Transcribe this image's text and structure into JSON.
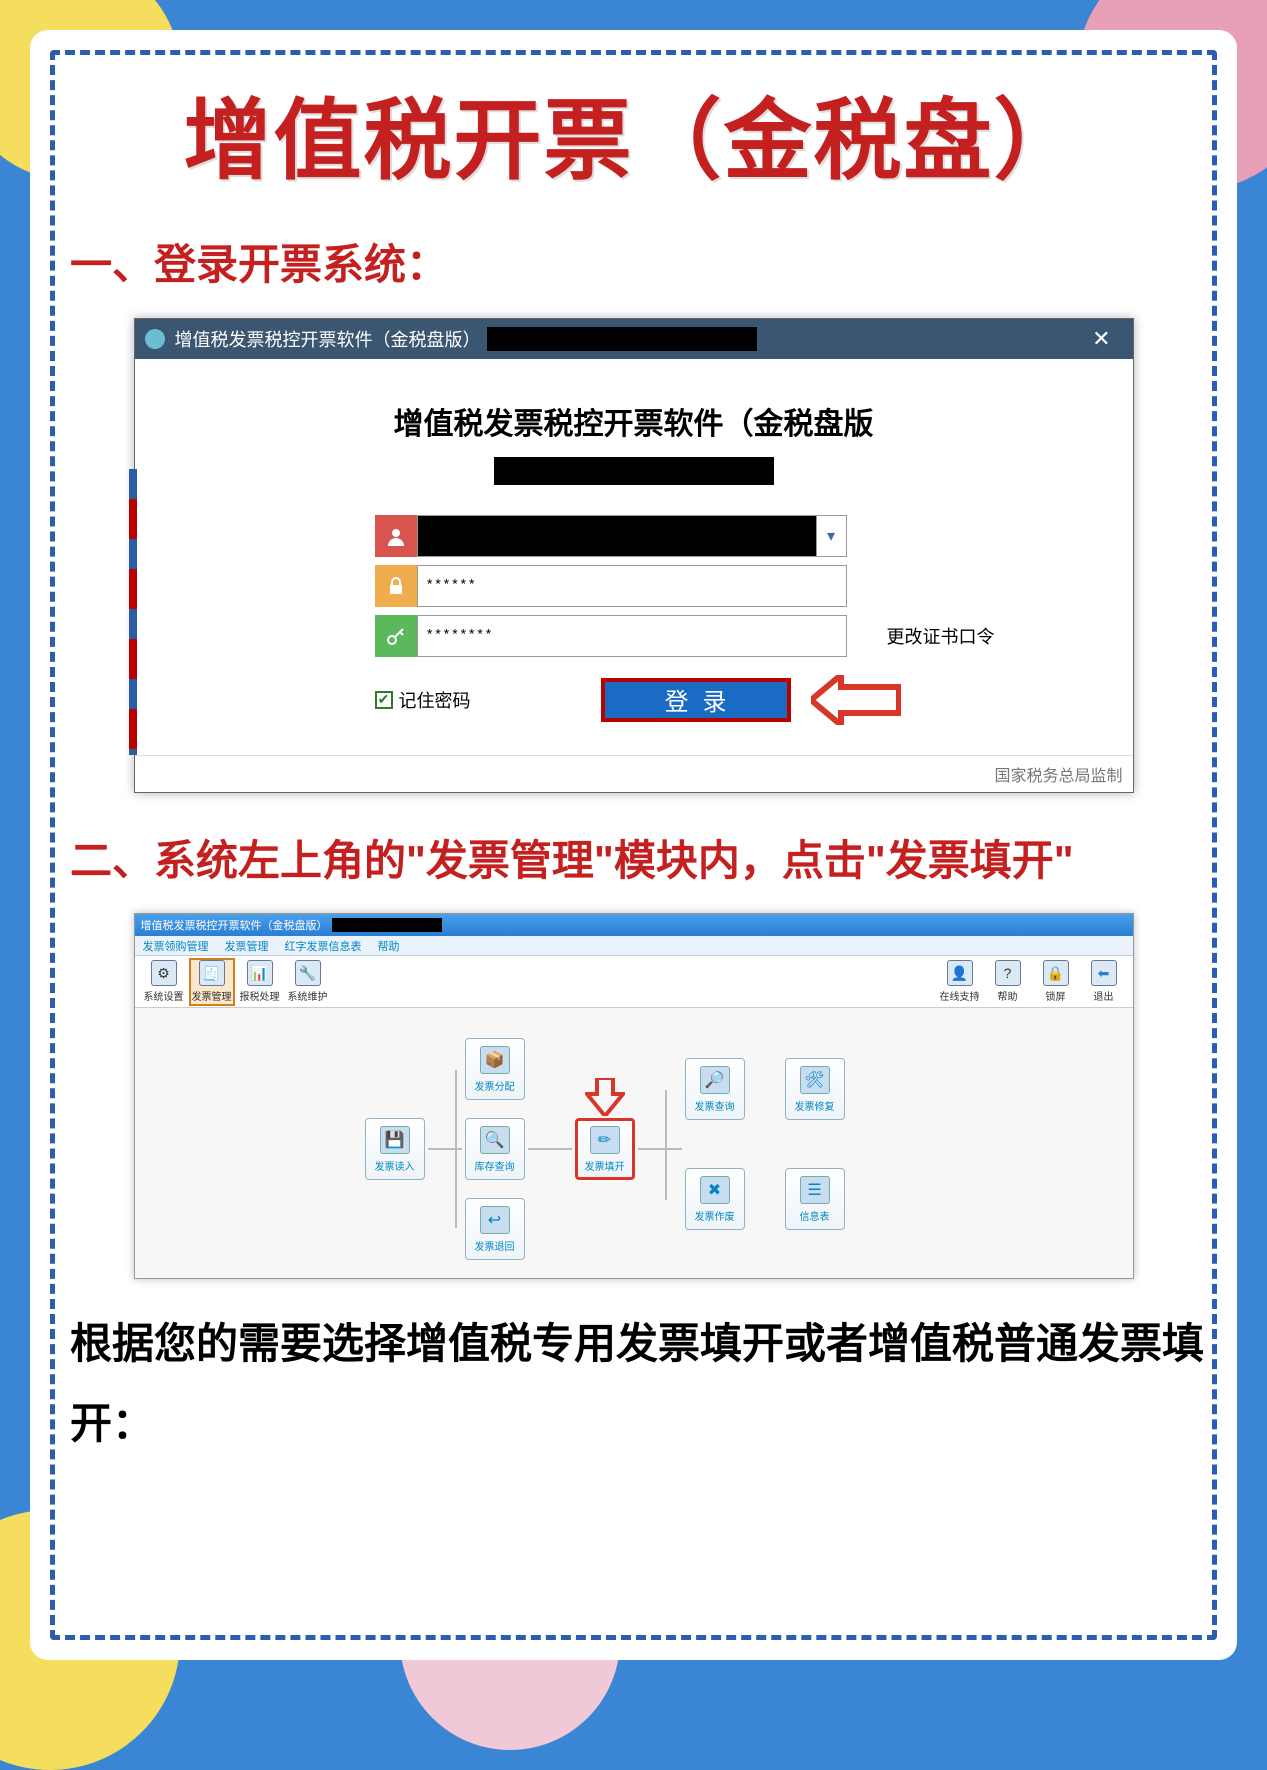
{
  "page_title": "增值税开票（金税盘）",
  "section1": "一、登录开票系统：",
  "login_window": {
    "titlebar_text": "增值税发票税控开票软件（金税盘版）",
    "heading": "增值税发票税控开票软件（金税盘版",
    "user_value": "",
    "pass_value": "******",
    "cert_value": "********",
    "change_cert_link": "更改证书口令",
    "remember_label": "记住密码",
    "login_btn": "登录",
    "footer": "国家税务总局监制",
    "close_icon": "✕"
  },
  "section2": "二、系统左上角的\"发票管理\"模块内，点击\"发票填开\"",
  "module_window": {
    "titlebar_text": "增值税发票税控开票软件（金税盘版）",
    "menu_items": [
      "发票领购管理",
      "发票管理",
      "红字发票信息表",
      "帮助"
    ],
    "toolbar_left": [
      {
        "label": "系统设置"
      },
      {
        "label": "发票管理",
        "highlight": true
      },
      {
        "label": "报税处理"
      },
      {
        "label": "系统维护"
      }
    ],
    "toolbar_right": [
      {
        "label": "在线支持"
      },
      {
        "label": "帮助"
      },
      {
        "label": "锁屏"
      },
      {
        "label": "退出"
      }
    ],
    "nodes": {
      "read": {
        "label": "发票读入"
      },
      "dist": {
        "label": "发票分配"
      },
      "stock": {
        "label": "库存查询"
      },
      "return": {
        "label": "发票退回"
      },
      "fill": {
        "label": "发票填开",
        "highlight": true
      },
      "query": {
        "label": "发票查询"
      },
      "void": {
        "label": "发票作废"
      },
      "repair": {
        "label": "发票修复"
      },
      "info": {
        "label": "信息表"
      }
    }
  },
  "body_text": "根据您的需要选择增值税专用发票填开或者增值税普通发票填开："
}
